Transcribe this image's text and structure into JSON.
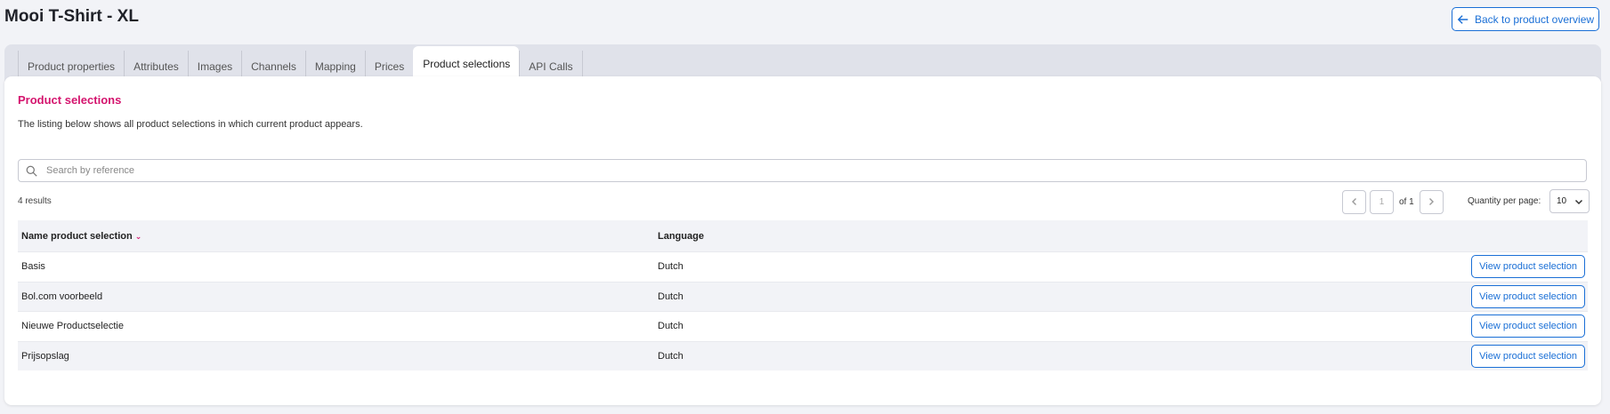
{
  "page": {
    "title": "Mooi T-Shirt - XL"
  },
  "header": {
    "back_label": "Back to product overview"
  },
  "tabs": [
    {
      "label": "Product properties"
    },
    {
      "label": "Attributes"
    },
    {
      "label": "Images"
    },
    {
      "label": "Channels"
    },
    {
      "label": "Mapping"
    },
    {
      "label": "Prices"
    },
    {
      "label": "Product selections",
      "active": true
    },
    {
      "label": "API Calls"
    }
  ],
  "section": {
    "title": "Product selections",
    "description": "The listing below shows all product selections in which current product appears."
  },
  "search": {
    "placeholder": "Search by reference",
    "value": ""
  },
  "results": {
    "text": "4 results"
  },
  "pagination": {
    "current_page": "1",
    "of_text": "of 1"
  },
  "quantity": {
    "label": "Quantity per page:",
    "selected": "10"
  },
  "table": {
    "headers": {
      "name": "Name product selection",
      "language": "Language"
    },
    "rows": [
      {
        "name": "Basis",
        "language": "Dutch",
        "action": "View product selection"
      },
      {
        "name": "Bol.com voorbeeld",
        "language": "Dutch",
        "action": "View product selection"
      },
      {
        "name": "Nieuwe Productselectie",
        "language": "Dutch",
        "action": "View product selection"
      },
      {
        "name": "Prijsopslag",
        "language": "Dutch",
        "action": "View product selection"
      }
    ]
  },
  "colors": {
    "accent": "#d4136d",
    "link": "#1a6fd6",
    "background": "#f2f3f7"
  },
  "icons": {
    "back": "arrow-left-icon",
    "search": "search-icon",
    "prev": "chevron-left-icon",
    "next": "chevron-right-icon",
    "dropdown": "chevron-down-icon",
    "sort": "sort-desc-icon"
  }
}
